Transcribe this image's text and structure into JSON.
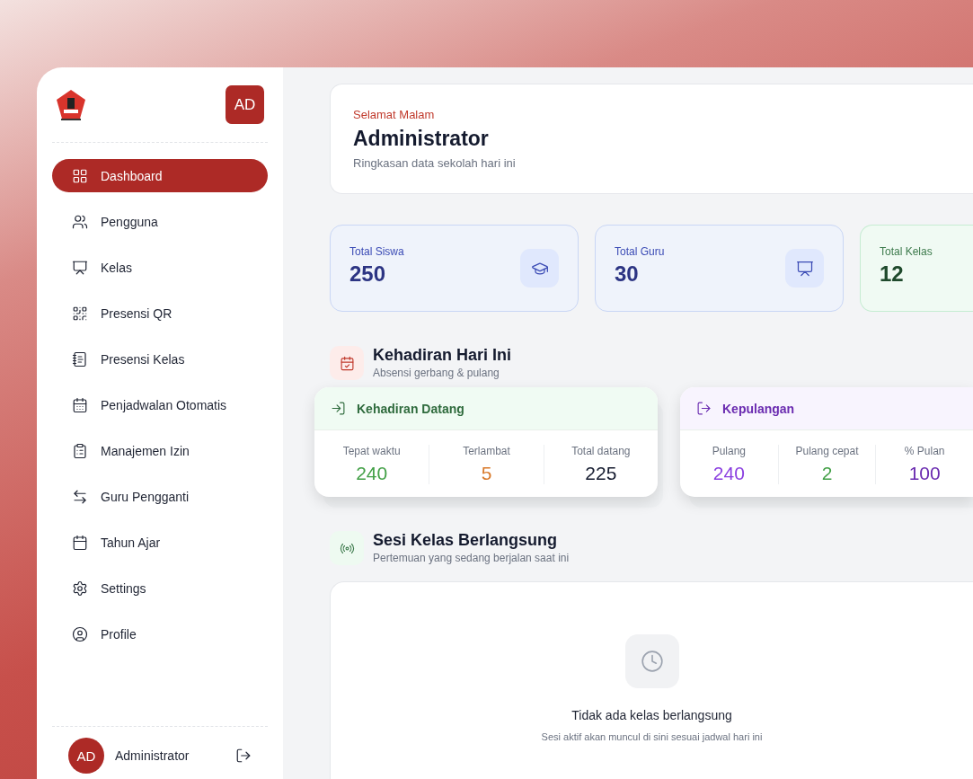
{
  "sidebar": {
    "avatar": "AD",
    "items": [
      {
        "label": "Dashboard",
        "selected": true
      },
      {
        "label": "Pengguna",
        "selected": false
      },
      {
        "label": "Kelas",
        "selected": false
      },
      {
        "label": "Presensi QR",
        "selected": false
      },
      {
        "label": "Presensi Kelas",
        "selected": false
      },
      {
        "label": "Penjadwalan Otomatis",
        "selected": false
      },
      {
        "label": "Manajemen Izin",
        "selected": false
      },
      {
        "label": "Guru Pengganti",
        "selected": false
      },
      {
        "label": "Tahun Ajar",
        "selected": false
      },
      {
        "label": "Settings",
        "selected": false
      },
      {
        "label": "Profile",
        "selected": false
      }
    ],
    "user": {
      "avatar": "AD",
      "name": "Administrator"
    }
  },
  "welcome": {
    "greeting": "Selamat Malam",
    "name": "Administrator",
    "subtitle": "Ringkasan data sekolah hari ini"
  },
  "stats": [
    {
      "label": "Total Siswa",
      "value": "250",
      "kind": "blue"
    },
    {
      "label": "Total Guru",
      "value": "30",
      "kind": "blue"
    },
    {
      "label": "Total Kelas",
      "value": "12",
      "kind": "green"
    }
  ],
  "attendance_section": {
    "title": "Kehadiran Hari Ini",
    "subtitle": "Absensi gerbang & pulang"
  },
  "attendance_cards": [
    {
      "title": "Kehadiran Datang",
      "kind": "green",
      "items": [
        {
          "label": "Tepat waktu",
          "value": "240",
          "color": "#43a047"
        },
        {
          "label": "Terlambat",
          "value": "5",
          "color": "#d97a2b"
        },
        {
          "label": "Total datang",
          "value": "225",
          "color": "#141a2e"
        }
      ]
    },
    {
      "title": "Kepulangan",
      "kind": "purple",
      "items": [
        {
          "label": "Pulang",
          "value": "240",
          "color": "#8b3fe0"
        },
        {
          "label": "Pulang cepat",
          "value": "2",
          "color": "#43a047"
        },
        {
          "label": "% Pulan",
          "value": "100",
          "color": "#6a2bb0"
        }
      ]
    }
  ],
  "session_section": {
    "title": "Sesi Kelas Berlangsung",
    "subtitle": "Pertemuan yang sedang berjalan saat ini"
  },
  "empty_state": {
    "title": "Tidak ada kelas berlangsung",
    "subtitle": "Sesi aktif akan muncul di sini sesuai jadwal hari ini"
  }
}
